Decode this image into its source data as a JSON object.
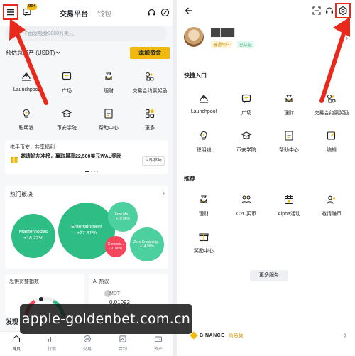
{
  "left": {
    "header": {
      "notification_badge": "99+",
      "tab_exchange": "交易平台",
      "tab_wallet": "钱包"
    },
    "search": {
      "placeholder": "MS 币 面对 币安 发 吸 金 3060万美元",
      "text": "MS      F面发吸金3060万美元"
    },
    "balance": {
      "label": "预估总资产 (USDT)",
      "add_funds": "添加资金"
    },
    "shortcuts": [
      {
        "label": "Launchpool",
        "icon": "launchpool-icon"
      },
      {
        "label": "广场",
        "icon": "square-icon"
      },
      {
        "label": "理财",
        "icon": "earn-icon"
      },
      {
        "label": "交易合约赢奖励",
        "icon": "rewards-icon"
      },
      {
        "label": "聪明钱",
        "icon": "smart-money-icon"
      },
      {
        "label": "币安学院",
        "icon": "academy-icon"
      },
      {
        "label": "帮助中心",
        "icon": "help-icon"
      },
      {
        "label": "更多",
        "icon": "more-icon"
      }
    ],
    "promo": {
      "title": "携手币安，共享福利",
      "text": "邀请好友冲榜，赢取最高22,500美元WAL奖励",
      "cta": "立即参与"
    },
    "hot_sectors": {
      "title": "热门板块",
      "bubbles": [
        {
          "name": "Masternodes",
          "change": "+18.22%"
        },
        {
          "name": "Entertainment",
          "change": "+27.91%"
        },
        {
          "name": "Fren Ma...",
          "change": "+10.96%"
        },
        {
          "name": "Genesis...",
          "change": "-10.06%"
        },
        {
          "name": "Zero Knowledg...",
          "change": "+14.09%"
        }
      ]
    },
    "fear_greed": {
      "title": "恐惧贪婪指数"
    },
    "ai_hot": {
      "title": "AI 热议",
      "coin": "MDT",
      "price": "0.01092"
    },
    "discover": "发现",
    "tabbar": [
      {
        "label": "首页",
        "icon": "home-icon"
      },
      {
        "label": "行情",
        "icon": "markets-icon"
      },
      {
        "label": "交易",
        "icon": "trade-icon"
      },
      {
        "label": "合约",
        "icon": "futures-icon"
      },
      {
        "label": "资产",
        "icon": "assets-icon"
      }
    ]
  },
  "right": {
    "profile": {
      "name": "██ ███",
      "tag_normal": "普通用户",
      "tag_verified": "已认证"
    },
    "quick_entry": {
      "title": "快捷入口",
      "items": [
        {
          "label": "Launchpool",
          "icon": "launchpool-icon"
        },
        {
          "label": "广场",
          "icon": "square-icon"
        },
        {
          "label": "理财",
          "icon": "earn-icon"
        },
        {
          "label": "交易合约赢奖励",
          "icon": "rewards-icon"
        },
        {
          "label": "聪明钱",
          "icon": "smart-money-icon"
        },
        {
          "label": "币安学院",
          "icon": "academy-icon"
        },
        {
          "label": "帮助中心",
          "icon": "help-icon"
        },
        {
          "label": "编辑",
          "icon": "edit-icon"
        }
      ]
    },
    "recommended": {
      "title": "推荐",
      "items": [
        {
          "label": "理财",
          "icon": "earn-icon"
        },
        {
          "label": "C2C买币",
          "icon": "c2c-icon"
        },
        {
          "label": "Alpha活动",
          "icon": "calendar-icon"
        },
        {
          "label": "邀请赚币",
          "icon": "invite-icon"
        },
        {
          "label": "奖励中心",
          "icon": "reward-center-icon"
        }
      ]
    },
    "more_services": "更多服务",
    "footer": {
      "brand": "BINANCE",
      "edition": "简易版"
    }
  },
  "watermark": "apple-goldenbet.com.cn",
  "colors": {
    "brand_yellow": "#f0b90b",
    "green": "#2ebd85",
    "red": "#f6465d",
    "annotation_red": "#e8291c"
  }
}
